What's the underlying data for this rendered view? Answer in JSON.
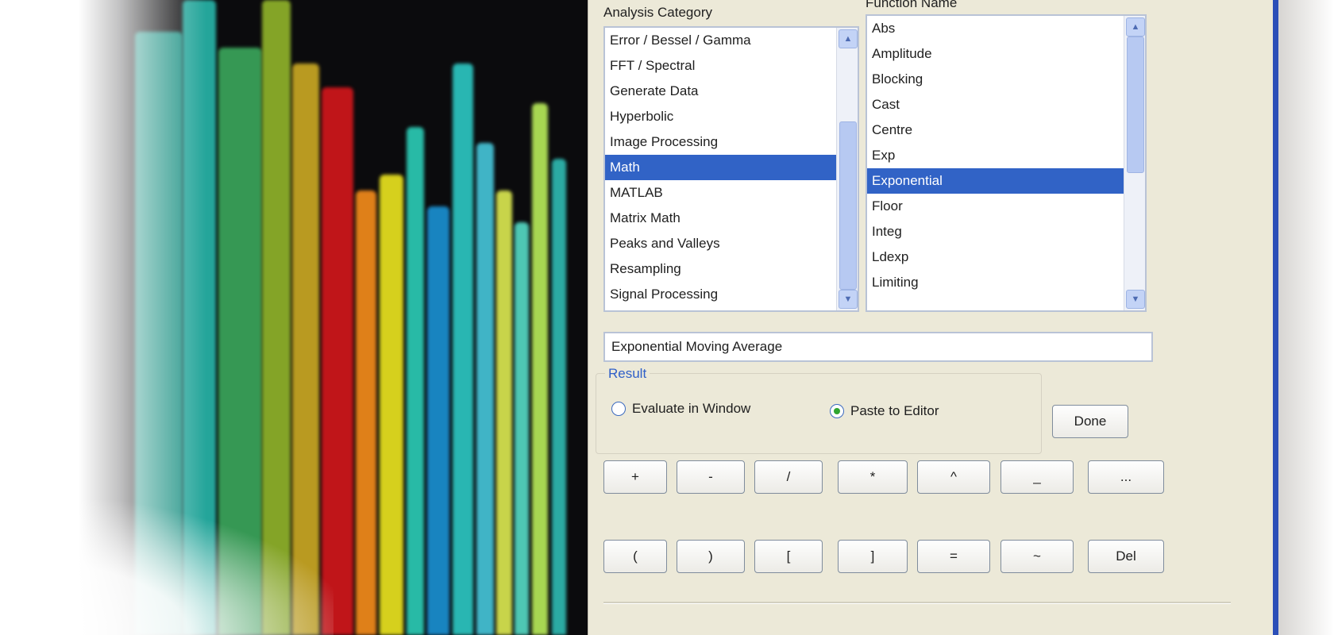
{
  "dialog": {
    "analysis_category_label": "Analysis Category",
    "function_name_label": "Function Name",
    "categories": [
      "Error / Bessel / Gamma",
      "FFT / Spectral",
      "Generate Data",
      "Hyperbolic",
      "Image Processing",
      "Math",
      "MATLAB",
      "Matrix Math",
      "Peaks and Valleys",
      "Resampling",
      "Signal Processing"
    ],
    "selected_category_index": 5,
    "functions": [
      "Abs",
      "Amplitude",
      "Blocking",
      "Cast",
      "Centre",
      "Exp",
      "Exponential",
      "Floor",
      "Integ",
      "Ldexp",
      "Limiting"
    ],
    "selected_function_index": 6,
    "description": "Exponential Moving Average",
    "result_label": "Result",
    "result_options": [
      "Evaluate in Window",
      "Paste to Editor"
    ],
    "selected_result_index": 1,
    "done_label": "Done",
    "operator_row_1": [
      "+",
      "-",
      "/",
      "*",
      "^",
      "_",
      "..."
    ],
    "operator_row_2": [
      "(",
      ")",
      "[",
      "]",
      "=",
      "~",
      "Del"
    ]
  },
  "colors": {
    "selection": "#3163c6",
    "dialog_bg": "#ece9d8",
    "frame_accent": "#2b4fb8",
    "result_title": "#2f5fc8"
  }
}
